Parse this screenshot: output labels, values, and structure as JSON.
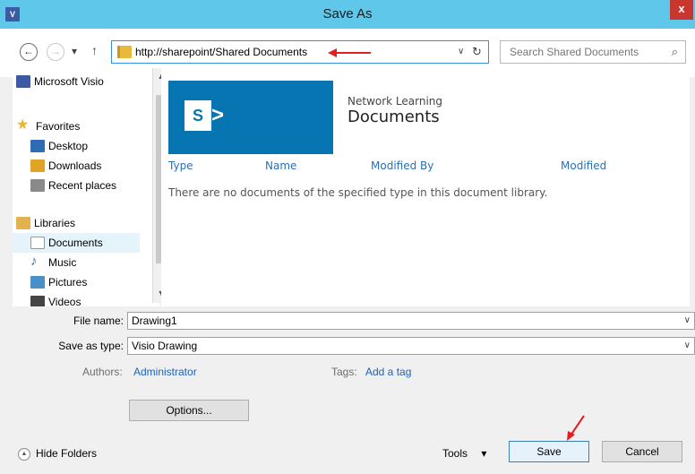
{
  "window": {
    "title": "Save As",
    "app_icon_text": "V",
    "close_glyph": "x"
  },
  "toolbar": {
    "back_glyph": "←",
    "forward_glyph": "→",
    "recent_glyph": "▾",
    "up_glyph": "↑",
    "address": "http://sharepoint/Shared Documents",
    "address_caret": "∨",
    "refresh_glyph": "↻",
    "search_placeholder": "Search Shared Documents",
    "search_glyph": "⌕"
  },
  "sidebar": {
    "items": [
      {
        "label": "Microsoft Visio",
        "icon": "visio-icon",
        "color": "#3b5ba5"
      },
      {
        "label": "Favorites",
        "icon": "star-icon",
        "color": "#f0b526"
      },
      {
        "label": "Desktop",
        "icon": "desktop-icon",
        "color": "#2e6db5"
      },
      {
        "label": "Downloads",
        "icon": "downloads-icon",
        "color": "#e0a325"
      },
      {
        "label": "Recent places",
        "icon": "recent-places-icon",
        "color": "#8a8a8a"
      },
      {
        "label": "Libraries",
        "icon": "libraries-icon",
        "color": "#e2b34d"
      },
      {
        "label": "Documents",
        "icon": "documents-icon",
        "color": "#dcdcdc",
        "selected": true
      },
      {
        "label": "Music",
        "icon": "music-icon",
        "color": "#2c72c9"
      },
      {
        "label": "Pictures",
        "icon": "pictures-icon",
        "color": "#4a90c8"
      },
      {
        "label": "Videos",
        "icon": "videos-icon",
        "color": "#444444"
      }
    ]
  },
  "library": {
    "logo_letter": "S",
    "logo_arrow": ">",
    "site_name": "Network Learning",
    "title": "Documents",
    "columns": [
      "Type",
      "Name",
      "Modified By",
      "Modified"
    ],
    "empty_message": "There are no documents of the specified type in this document library."
  },
  "form": {
    "file_name_label": "File name:",
    "file_name_value": "Drawing1",
    "save_type_label": "Save as type:",
    "save_type_value": "Visio Drawing",
    "dropdown_glyph": "∨",
    "authors_label": "Authors:",
    "authors_value": "Administrator",
    "tags_label": "Tags:",
    "tags_value": "Add a tag",
    "options_label": "Options..."
  },
  "footer": {
    "hide_folders_glyph": "▲",
    "hide_folders_label": "Hide Folders",
    "tools_label": "Tools",
    "tools_caret": "▾",
    "save_label": "Save",
    "cancel_label": "Cancel"
  },
  "colors": {
    "title_bar": "#5fc7e9",
    "close_button": "#c7372f",
    "sharepoint_blue": "#0875b3",
    "link_blue": "#1c62b9",
    "annotation_red": "#e02020"
  }
}
